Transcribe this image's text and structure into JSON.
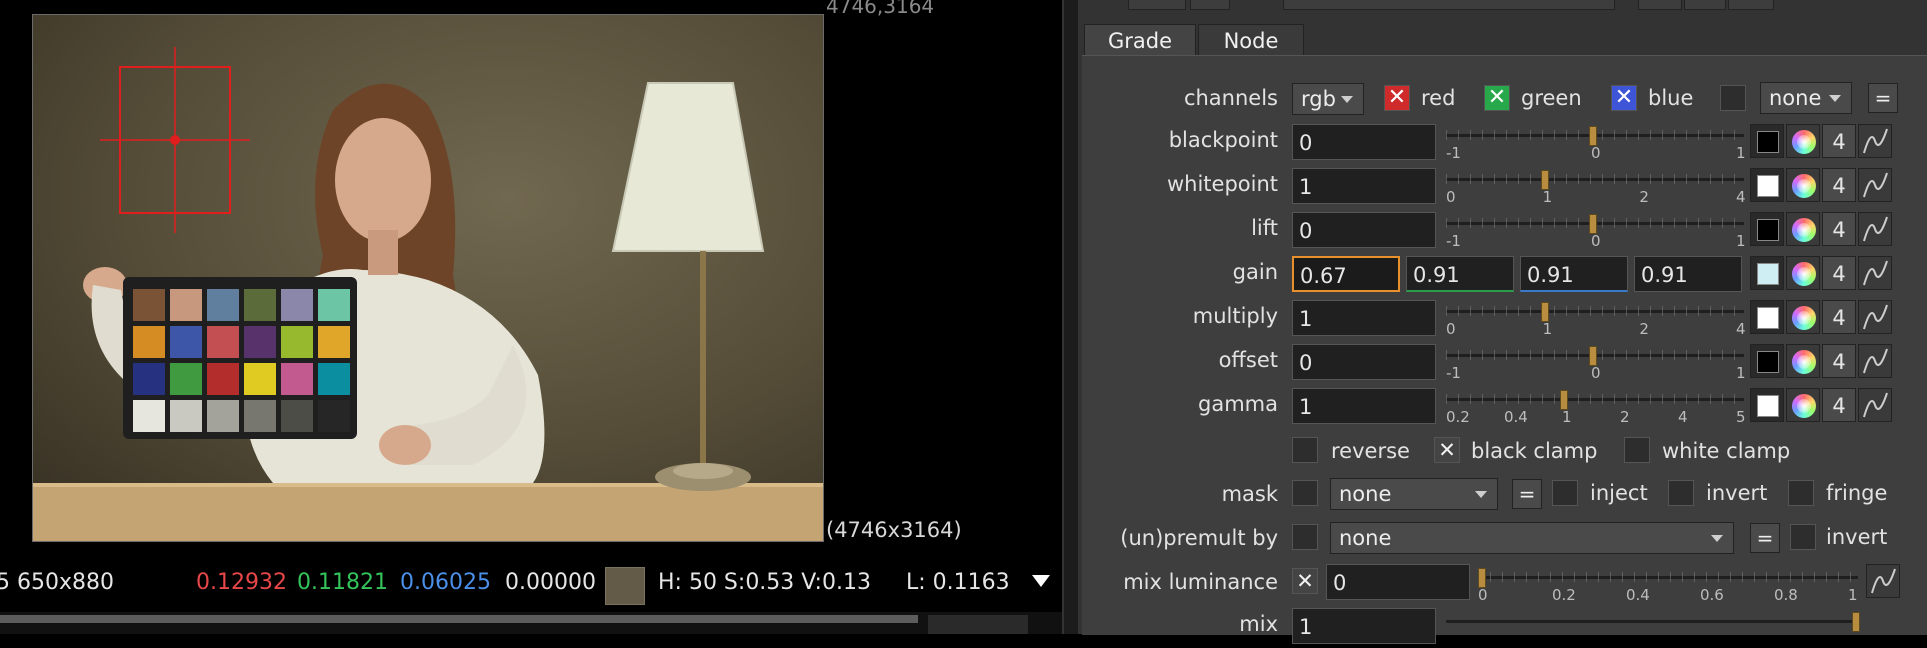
{
  "viewer": {
    "coord_top": "4746,3164",
    "coord_bottom": "(4746x3164)",
    "info": {
      "region": "5 650x880",
      "r": "0.12932",
      "g": "0.11821",
      "b": "0.06025",
      "a": "0.00000",
      "hsv": "H: 50 S:0.53 V:0.13",
      "luma": "L: 0.1163",
      "colors": {
        "r": "#e8474a",
        "g": "#33c45a",
        "b": "#4b8fe8",
        "a": "#e6e6e6"
      }
    }
  },
  "tabs": [
    {
      "label": "Grade"
    },
    {
      "label": "Node"
    }
  ],
  "channels": {
    "label": "channels",
    "value": "rgb",
    "red": "red",
    "green": "green",
    "blue": "blue",
    "extra": "none",
    "eq": "="
  },
  "rows": [
    {
      "label": "blackpoint",
      "value": "0",
      "ticks": [
        "-1",
        "0",
        "1"
      ],
      "swatch": "#000000",
      "count": "4"
    },
    {
      "label": "whitepoint",
      "value": "1",
      "ticks": [
        "0",
        "1",
        "2",
        "4"
      ],
      "swatch": "#ffffff",
      "count": "4"
    },
    {
      "label": "lift",
      "value": "0",
      "ticks": [
        "-1",
        "0",
        "1"
      ],
      "swatch": "#000000",
      "count": "4"
    },
    {
      "label": "gain",
      "values": [
        "0.67",
        "0.91",
        "0.91",
        "0.91"
      ],
      "swatch": "#cfeef3",
      "count": "4"
    },
    {
      "label": "multiply",
      "value": "1",
      "ticks": [
        "0",
        "1",
        "2",
        "4"
      ],
      "swatch": "#ffffff",
      "count": "4"
    },
    {
      "label": "offset",
      "value": "0",
      "ticks": [
        "-1",
        "0",
        "1"
      ],
      "swatch": "#000000",
      "count": "4"
    },
    {
      "label": "gamma",
      "value": "1",
      "ticks": [
        "0.2",
        "0.4",
        "1",
        "2",
        "4",
        "5"
      ],
      "swatch": "#ffffff",
      "count": "4"
    }
  ],
  "options": {
    "reverse": "reverse",
    "black_clamp": "black clamp",
    "white_clamp": "white clamp"
  },
  "mask": {
    "label": "mask",
    "value": "none",
    "eq": "=",
    "inject": "inject",
    "invert": "invert",
    "fringe": "fringe"
  },
  "premult": {
    "label": "(un)premult by",
    "value": "none",
    "eq": "=",
    "invert": "invert"
  },
  "mix_luminance": {
    "label": "mix luminance",
    "value": "0",
    "ticks": [
      "0",
      "0.2",
      "0.4",
      "0.6",
      "0.8",
      "1"
    ]
  },
  "mix": {
    "label": "mix",
    "value": "1"
  }
}
